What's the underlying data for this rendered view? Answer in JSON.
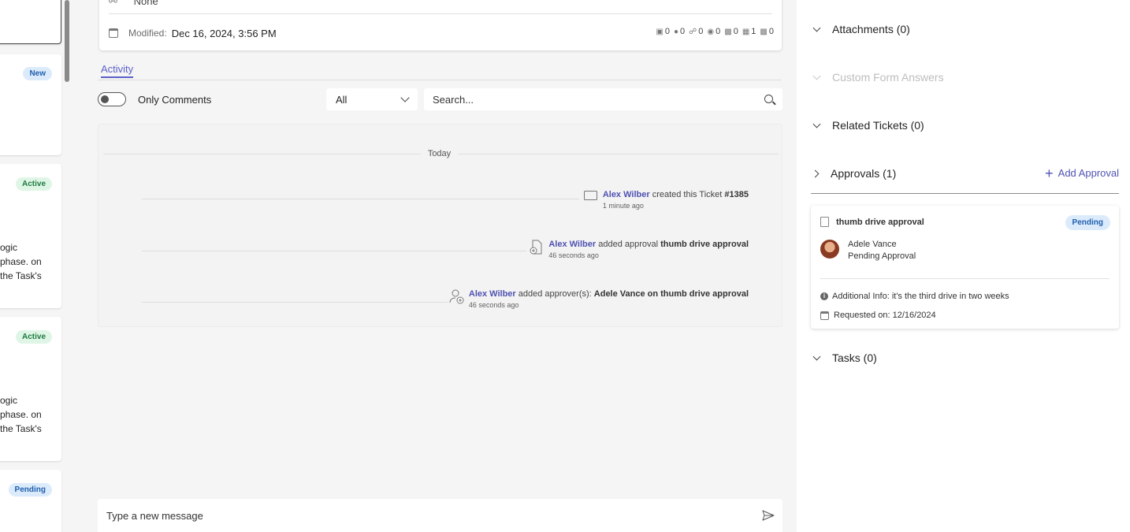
{
  "left_cards": [
    {
      "badge": "New",
      "badge_type": "new",
      "lines": []
    },
    {
      "badge": "Active",
      "badge_type": "active",
      "lines": [
        "ogic",
        "phase. on",
        "the Task's"
      ]
    },
    {
      "badge": "Active",
      "badge_type": "active",
      "lines": [
        "ogic",
        "phase. on",
        "the Task's"
      ]
    },
    {
      "badge": "Pending",
      "badge_type": "pending",
      "lines": []
    }
  ],
  "ticket": {
    "top_value": "None",
    "modified_label": "Modified:",
    "modified_value": "Dec 16, 2024, 3:56 PM",
    "counts": [
      "0",
      "0",
      "0",
      "0",
      "0",
      "1",
      "0"
    ]
  },
  "activity": {
    "tab_label": "Activity",
    "toggle_label": "Only Comments",
    "filter_value": "All",
    "search_placeholder": "Search...",
    "date_separator": "Today",
    "entries": [
      {
        "actor": "Alex Wilber",
        "action": "created this Ticket",
        "target": "#1385",
        "time": "1 minute ago",
        "icon": "ticket-icon"
      },
      {
        "actor": "Alex Wilber",
        "action": "added approval",
        "target": "thumb drive approval",
        "time": "46 seconds ago",
        "icon": "add-document-icon"
      },
      {
        "actor": "Alex Wilber",
        "action": "added approver(s):",
        "target": "Adele Vance on thumb drive approval",
        "time": "46 seconds ago",
        "icon": "add-person-icon"
      }
    ]
  },
  "composer": {
    "placeholder": "Type a new message"
  },
  "right_panel": {
    "sections": {
      "attachments": "Attachments (0)",
      "custom_form": "Custom Form Answers",
      "related": "Related Tickets (0)",
      "approvals": "Approvals (1)",
      "tasks": "Tasks (0)"
    },
    "add_approval": "Add Approval",
    "approval_card": {
      "title": "thumb drive approval",
      "status": "Pending",
      "approver_name": "Adele Vance",
      "approver_status": "Pending Approval",
      "additional_info": "Additional Info: it's the third drive in two weeks",
      "requested_on": "Requested on: 12/16/2024"
    }
  },
  "colors": {
    "accent": "#5b5fc7",
    "link": "#4f52b2",
    "pending_bg": "#dcebfb",
    "active_bg": "#dff6e7"
  }
}
